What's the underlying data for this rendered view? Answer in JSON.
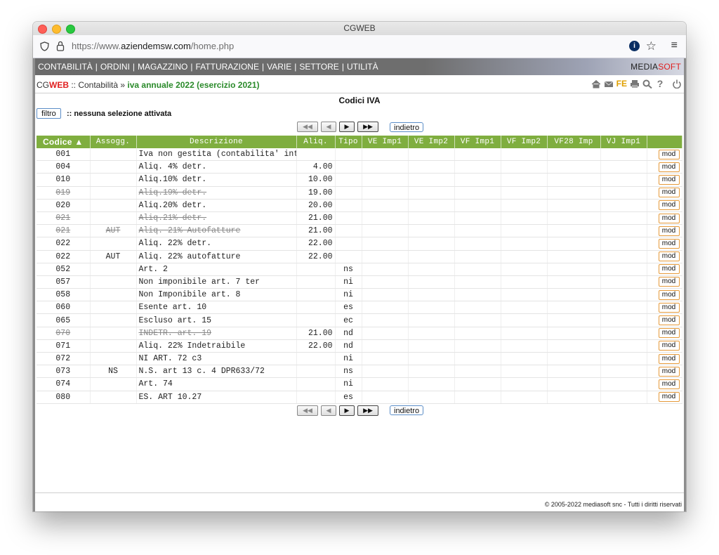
{
  "browser": {
    "window_title": "CGWEB",
    "url_prefix": "https://www.",
    "url_domain": "aziendemsw.com",
    "url_path": "/home.php"
  },
  "menu": {
    "items": [
      "CONTABILITÀ",
      "ORDINI",
      "MAGAZZINO",
      "FATTURAZIONE",
      "VARIE",
      "SETTORE",
      "UTILITÀ"
    ],
    "brand_left": "MEDIA",
    "brand_right": "SOFT"
  },
  "breadcrumb": {
    "cg": "CG",
    "web": "WEB",
    "middle": " :: Contabilità » ",
    "active": "iva annuale 2022 (esercizio 2021)"
  },
  "toolbar": {
    "fe_label": "FE"
  },
  "page": {
    "title": "Codici IVA",
    "filter_label": "filtro",
    "filter_status": ":: nessuna selezione attivata",
    "back_label": "indietro"
  },
  "table": {
    "headers": [
      "Codice ▲",
      "Assogg.",
      "Descrizione",
      "Aliq.",
      "Tipo",
      "VE Imp1",
      "VE Imp2",
      "VF Imp1",
      "VF Imp2",
      "VF28 Imp",
      "VJ Imp1",
      ""
    ],
    "action_label": "mod",
    "rows": [
      {
        "codice": "001",
        "assogg": "",
        "descrizione": "Iva non gestita (contabilita' int",
        "aliq": "",
        "tipo": "",
        "deleted": false
      },
      {
        "codice": "004",
        "assogg": "",
        "descrizione": "Aliq. 4% detr.",
        "aliq": "4.00",
        "tipo": "",
        "deleted": false
      },
      {
        "codice": "010",
        "assogg": "",
        "descrizione": "Aliq.10% detr.",
        "aliq": "10.00",
        "tipo": "",
        "deleted": false
      },
      {
        "codice": "019",
        "assogg": "",
        "descrizione": "Aliq.19% detr.",
        "aliq": "19.00",
        "tipo": "",
        "deleted": true
      },
      {
        "codice": "020",
        "assogg": "",
        "descrizione": "Aliq.20% detr.",
        "aliq": "20.00",
        "tipo": "",
        "deleted": false
      },
      {
        "codice": "021",
        "assogg": "",
        "descrizione": "Aliq.21% detr.",
        "aliq": "21.00",
        "tipo": "",
        "deleted": true
      },
      {
        "codice": "021",
        "assogg": "AUT",
        "descrizione": "Aliq. 21% Autofatture",
        "aliq": "21.00",
        "tipo": "",
        "deleted": true
      },
      {
        "codice": "022",
        "assogg": "",
        "descrizione": "Aliq. 22% detr.",
        "aliq": "22.00",
        "tipo": "",
        "deleted": false
      },
      {
        "codice": "022",
        "assogg": "AUT",
        "descrizione": "Aliq. 22% autofatture",
        "aliq": "22.00",
        "tipo": "",
        "deleted": false
      },
      {
        "codice": "052",
        "assogg": "",
        "descrizione": "Art. 2",
        "aliq": "",
        "tipo": "ns",
        "deleted": false
      },
      {
        "codice": "057",
        "assogg": "",
        "descrizione": "Non imponibile art. 7 ter",
        "aliq": "",
        "tipo": "ni",
        "deleted": false
      },
      {
        "codice": "058",
        "assogg": "",
        "descrizione": "Non Imponibile art. 8",
        "aliq": "",
        "tipo": "ni",
        "deleted": false
      },
      {
        "codice": "060",
        "assogg": "",
        "descrizione": "Esente art. 10",
        "aliq": "",
        "tipo": "es",
        "deleted": false
      },
      {
        "codice": "065",
        "assogg": "",
        "descrizione": "Escluso art. 15",
        "aliq": "",
        "tipo": "ec",
        "deleted": false
      },
      {
        "codice": "070",
        "assogg": "",
        "descrizione": "INDETR. art. 19",
        "aliq": "21.00",
        "tipo": "nd",
        "deleted": true
      },
      {
        "codice": "071",
        "assogg": "",
        "descrizione": "Aliq. 22% Indetraibile",
        "aliq": "22.00",
        "tipo": "nd",
        "deleted": false
      },
      {
        "codice": "072",
        "assogg": "",
        "descrizione": "NI ART. 72 c3",
        "aliq": "",
        "tipo": "ni",
        "deleted": false
      },
      {
        "codice": "073",
        "assogg": "NS",
        "descrizione": "N.S. art 13 c. 4 DPR633/72",
        "aliq": "",
        "tipo": "ns",
        "deleted": false
      },
      {
        "codice": "074",
        "assogg": "",
        "descrizione": "Art. 74",
        "aliq": "",
        "tipo": "ni",
        "deleted": false
      },
      {
        "codice": "080",
        "assogg": "",
        "descrizione": "ES. ART 10.27",
        "aliq": "",
        "tipo": "es",
        "deleted": false
      }
    ]
  },
  "footer": {
    "copyright": "© 2005-2022 mediasoft snc - Tutti i diritti riservati"
  },
  "colors": {
    "header_green": "#7fae3f",
    "active_crumb": "#2a8a2a",
    "brand_red": "#e02020",
    "mod_border": "#e59a3a"
  }
}
